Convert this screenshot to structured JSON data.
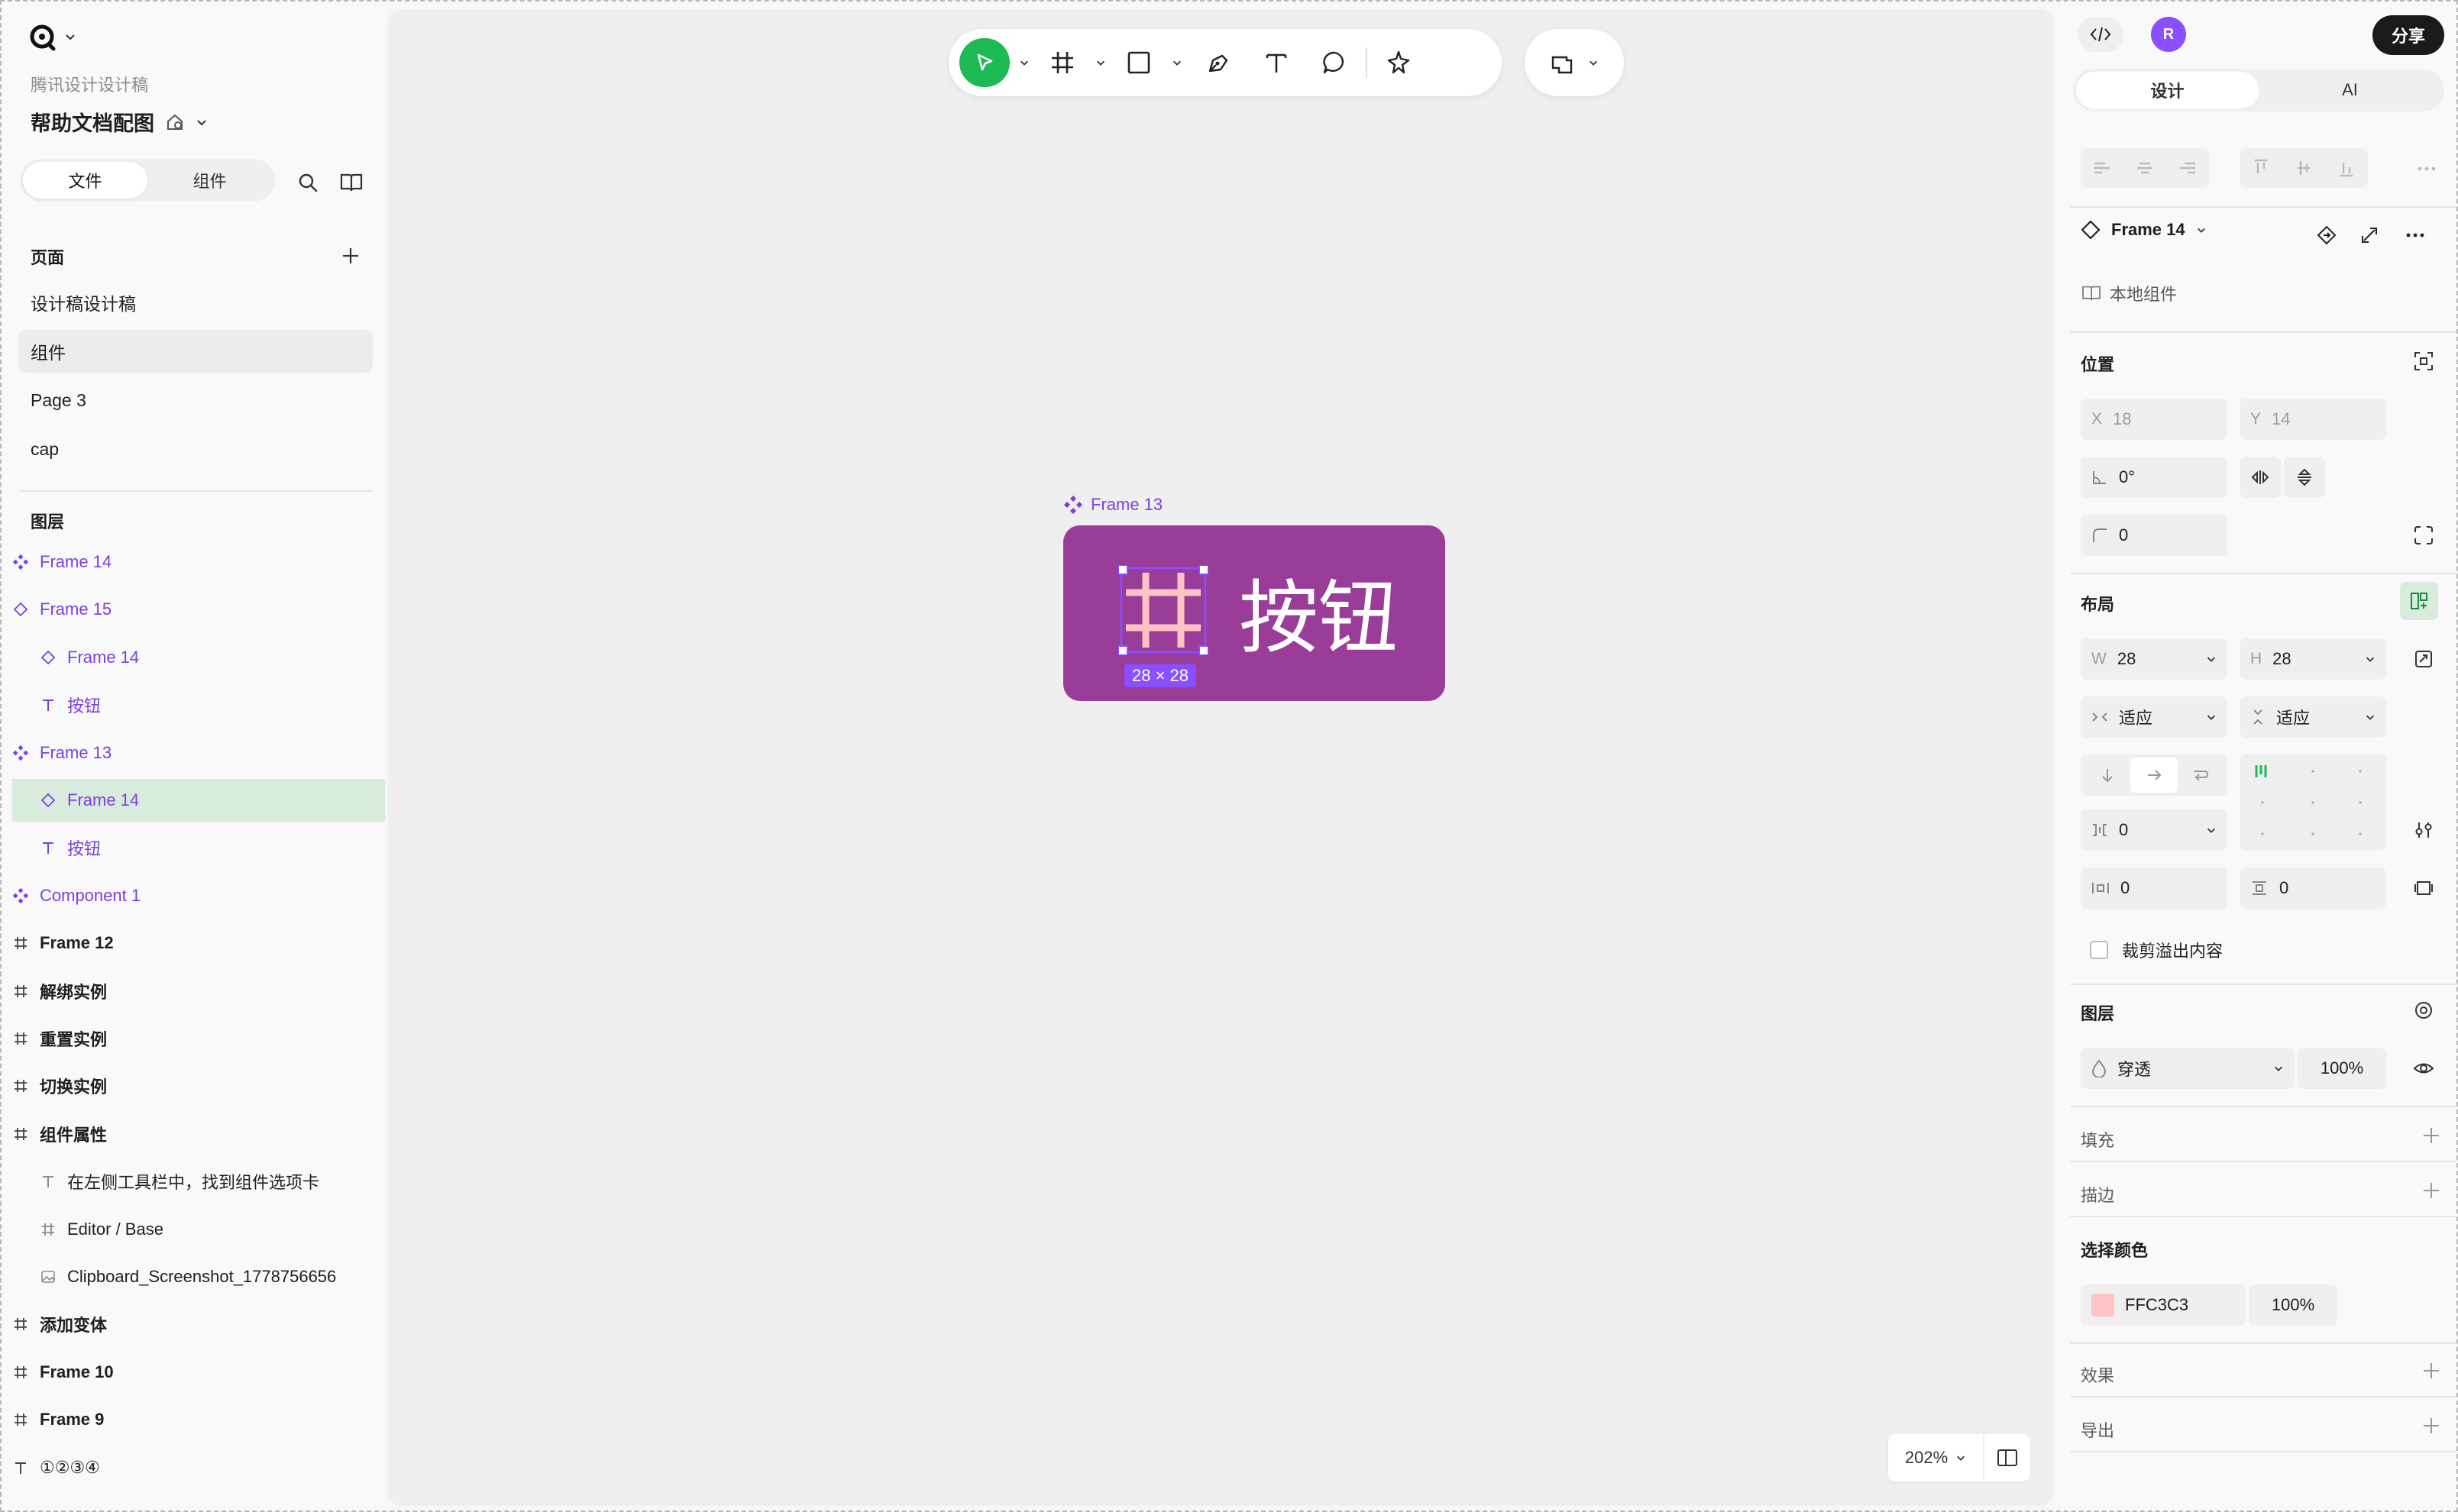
{
  "left": {
    "team": "腾讯设计设计稿",
    "project_title": "帮助文档配图",
    "tabs": [
      "文件",
      "组件"
    ],
    "pages_header": "页面",
    "pages": [
      "设计稿设计稿",
      "组件",
      "Page 3",
      "cap"
    ],
    "layers_header": "图层",
    "layers": [
      {
        "label": "Frame 14",
        "icon": "component-icon"
      },
      {
        "label": "Frame 15",
        "icon": "instance-icon"
      },
      {
        "label": "Frame 14",
        "icon": "instance-icon"
      },
      {
        "label": "按钮",
        "icon": "text-icon"
      },
      {
        "label": "Frame 13",
        "icon": "component-icon"
      },
      {
        "label": "Frame 14",
        "icon": "instance-icon"
      },
      {
        "label": "按钮",
        "icon": "text-icon"
      },
      {
        "label": "Component 1",
        "icon": "component-icon"
      },
      {
        "label": "Frame 12",
        "icon": "frame-icon"
      },
      {
        "label": "解绑实例",
        "icon": "frame-icon"
      },
      {
        "label": "重置实例",
        "icon": "frame-icon"
      },
      {
        "label": "切换实例",
        "icon": "frame-icon"
      },
      {
        "label": "组件属性",
        "icon": "frame-icon"
      },
      {
        "label": "在左侧工具栏中，找到组件选项卡",
        "icon": "text-icon"
      },
      {
        "label": "Editor / Base",
        "icon": "frame-icon"
      },
      {
        "label": "Clipboard_Screenshot_1778756656",
        "icon": "image-icon"
      },
      {
        "label": "添加变体",
        "icon": "frame-icon"
      },
      {
        "label": "Frame 10",
        "icon": "frame-icon"
      },
      {
        "label": "Frame 9",
        "icon": "frame-icon"
      },
      {
        "label": "①②③④",
        "icon": "text-icon"
      }
    ]
  },
  "canvas": {
    "frame_label": "Frame 13",
    "button_text": "按钮",
    "size_badge": "28 × 28",
    "zoom": "202%",
    "colors": {
      "button_bg": "#993D99",
      "grid_icon": "#FFC3C3",
      "selection": "#8A4FFF",
      "select_tool": "#1DB954"
    }
  },
  "right": {
    "avatar_initial": "R",
    "share_label": "分享",
    "tabs": [
      "设计",
      "AI"
    ],
    "component_name": "Frame 14",
    "local_component": "本地组件",
    "position_header": "位置",
    "x_label": "X",
    "x_value": "18",
    "y_label": "Y",
    "y_value": "14",
    "rotation": "0°",
    "radius": "0",
    "layout_header": "布局",
    "w_label": "W",
    "w_value": "28",
    "h_label": "H",
    "h_value": "28",
    "w_mode": "适应",
    "h_mode": "适应",
    "gap_value": "0",
    "padding_h": "0",
    "padding_v": "0",
    "clip_label": "裁剪溢出内容",
    "layer_header": "图层",
    "blend_mode": "穿透",
    "opacity": "100%",
    "fill_header": "填充",
    "stroke_header": "描边",
    "selection_colors_header": "选择颜色",
    "selection_color_hex": "FFC3C3",
    "selection_color_opacity": "100%",
    "effects_header": "效果",
    "export_header": "导出"
  }
}
